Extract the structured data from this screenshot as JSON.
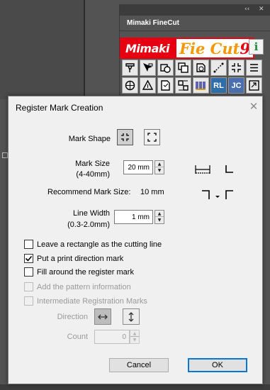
{
  "palette": {
    "controls": {
      "collapse": "‹‹",
      "close": "✕"
    },
    "tab": "Mimaki FineCut",
    "logo": {
      "brand": "Mimaki",
      "product_a": "Fi",
      "product_b": "e Cut",
      "product_c": "9"
    },
    "info_label": "i",
    "tools": [
      "plot-icon",
      "cursor-plot-icon",
      "outline-icon",
      "layer-icon",
      "contour-icon",
      "curve-icon",
      "register-mark-icon",
      "list-icon",
      "target-icon",
      "triangle-icon",
      "document-icon",
      "grid-icon",
      "barcode-icon",
      "rl-icon",
      "jc-icon",
      "export-icon"
    ],
    "tool_texts": {
      "rl": "RL",
      "jc": "JC"
    }
  },
  "dialog": {
    "title": "Register Mark Creation",
    "close_glyph": "✕",
    "mark_shape_label": "Mark Shape",
    "mark_size_label_1": "Mark Size",
    "mark_size_label_2": "(4-40mm)",
    "mark_size_value": "20 mm",
    "recommend_label": "Recommend Mark Size:",
    "recommend_value": "10 mm",
    "line_width_label_1": "Line Width",
    "line_width_label_2": "(0.3-2.0mm)",
    "line_width_value": "1 mm",
    "checkboxes": [
      {
        "label": "Leave a rectangle as the cutting line",
        "checked": false,
        "enabled": true
      },
      {
        "label": "Put a print direction mark",
        "checked": true,
        "enabled": true
      },
      {
        "label": "Fill around the register mark",
        "checked": false,
        "enabled": true
      },
      {
        "label": "Add the pattern information",
        "checked": false,
        "enabled": false
      },
      {
        "label": "Intermediate Registration Marks",
        "checked": false,
        "enabled": false
      }
    ],
    "direction_label": "Direction",
    "count_label": "Count",
    "count_value": "0",
    "cancel_label": "Cancel",
    "ok_label": "OK",
    "spin_up": "▲",
    "spin_down": "▼"
  },
  "colors": {
    "background": "#535353",
    "mimaki_red": "#e60012",
    "finecut_orange": "#f39800",
    "default_button_border": "#0078d7"
  }
}
